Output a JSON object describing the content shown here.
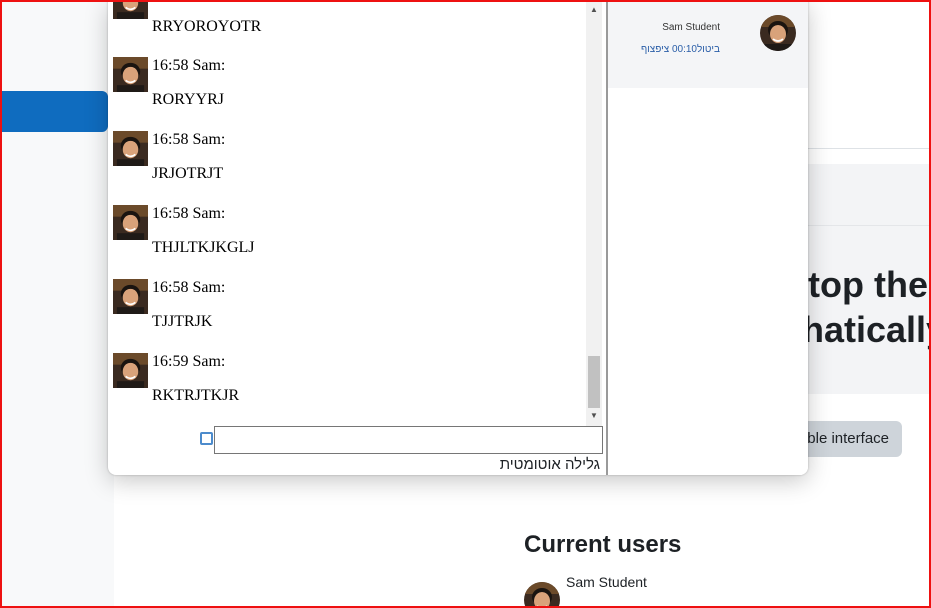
{
  "chat": {
    "messages": [
      {
        "meta": "",
        "text": "RRYOROYOTR"
      },
      {
        "meta": "16:58 Sam:",
        "text": "RORYYRJ"
      },
      {
        "meta": "16:58 Sam:",
        "text": "JRJOTRJT"
      },
      {
        "meta": "16:58 Sam:",
        "text": "THJLTKJKGLJ"
      },
      {
        "meta": "16:58 Sam:",
        "text": "TJJTRJK"
      },
      {
        "meta": "16:59 Sam:",
        "text": "RKTRJTKJR"
      }
    ],
    "input_value": "",
    "autoscroll_label": "גלילה אוטומטית",
    "autoscroll_checked": false
  },
  "users_panel": {
    "user_name": "Sam Student",
    "idle_label": "ביטול",
    "idle_time": "00:10",
    "beep_link": "ציפצוף"
  },
  "background": {
    "heading_line1": "top the",
    "heading_line2": "hatically",
    "button_label": "ble interface",
    "current_users_title": "Current users",
    "current_user_name": "Sam Student"
  },
  "colors": {
    "accent": "#0f6cbf",
    "link": "#2a5ea8",
    "window_border": "#ff0000"
  },
  "icons": {
    "avatar": "user-avatar-icon",
    "checkbox": "checkbox-icon",
    "scroll_up": "arrow-up-icon",
    "scroll_down": "arrow-down-icon"
  }
}
